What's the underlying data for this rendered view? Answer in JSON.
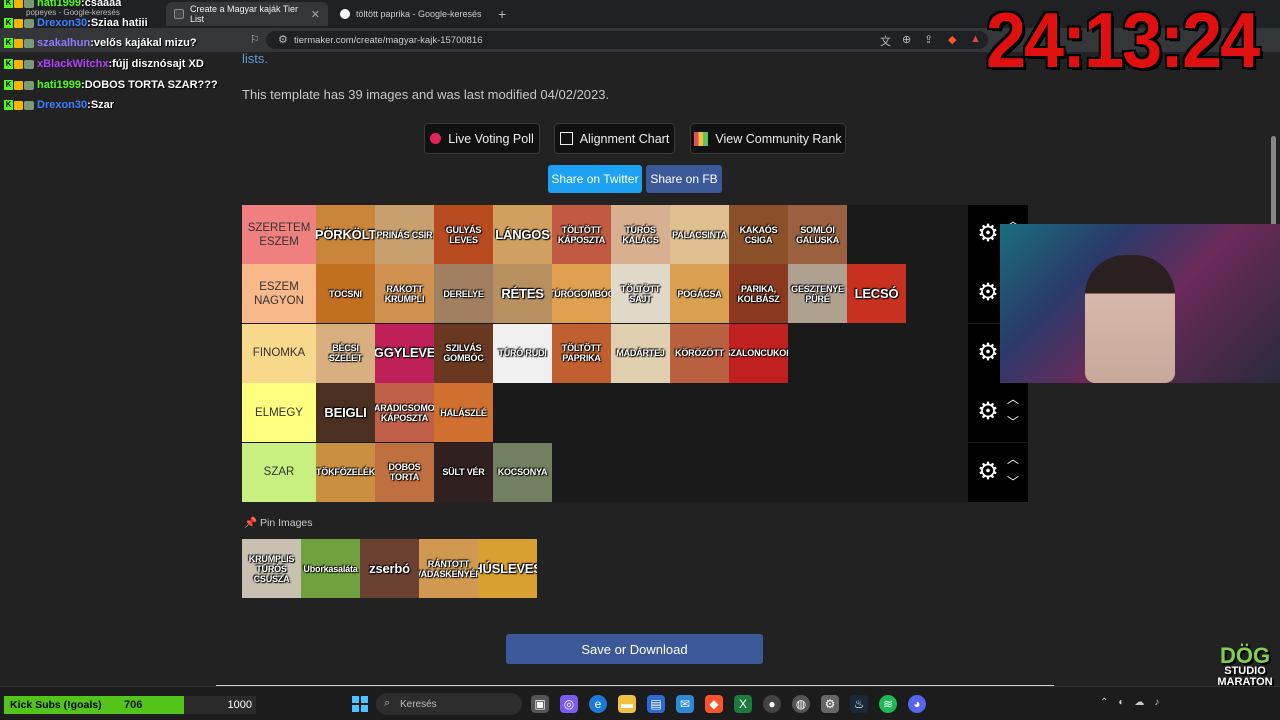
{
  "browser": {
    "tabs": [
      {
        "title": "Create a Magyar kaják Tier List",
        "active": true
      },
      {
        "title": "töltött paprika - Google-keresés",
        "active": false
      }
    ],
    "popup_tab": "popeyes - Google-keresés",
    "url": "tiermaker.com/create/magyar-kajk-15700816"
  },
  "page": {
    "lists_link": "lists.",
    "template_info": "This template has 39 images and was last modified 04/02/2023.",
    "buttons": {
      "live_voting": "Live Voting Poll",
      "alignment": "Alignment Chart",
      "community": "View Community Rank",
      "share_twitter": "Share on Twitter",
      "share_fb": "Share on FB",
      "save": "Save or Download"
    },
    "pin_label": "Pin Images",
    "tiers": [
      {
        "label": "SZERETEM ESZEM",
        "color": "#f08080",
        "items": [
          {
            "text": "PÖRKÖLT",
            "bg": "#c9853a",
            "big": true
          },
          {
            "text": "PRINÁS CSIR",
            "bg": "#c8a070"
          },
          {
            "text": "GULYÁS LEVES",
            "bg": "#b84a20"
          },
          {
            "text": "LÁNGOS",
            "bg": "#d0a060",
            "big": true
          },
          {
            "text": "TÖLTÖTT KÁPOSZTA",
            "bg": "#c05a40"
          },
          {
            "text": "TÚRÓS KALÁCS",
            "bg": "#d8b090"
          },
          {
            "text": "PALACSINTA",
            "bg": "#e0c090"
          },
          {
            "text": "KAKAÓS CSIGA",
            "bg": "#8a5028"
          },
          {
            "text": "SOMLÓI GALUSKA",
            "bg": "#9a6040"
          }
        ]
      },
      {
        "label": "ESZEM NAGYON",
        "color": "#f8b88a",
        "items": [
          {
            "text": "TOCSNI",
            "bg": "#c07020"
          },
          {
            "text": "RAKOTT KRUMPLI",
            "bg": "#d09050"
          },
          {
            "text": "DERELYE",
            "bg": "#a08060"
          },
          {
            "text": "RÉTES",
            "bg": "#b89060",
            "big": true
          },
          {
            "text": "TÚRÓGOMBÓC",
            "bg": "#e0a050"
          },
          {
            "text": "TÖLTÖTT SAJT",
            "bg": "#e0d8c8"
          },
          {
            "text": "POGÁCSA",
            "bg": "#d8a050"
          },
          {
            "text": "PARIKA, KOLBÁSZ",
            "bg": "#8a3820"
          },
          {
            "text": "GESZTENYE PÜRÉ",
            "bg": "#b0a090"
          },
          {
            "text": "LECSÓ",
            "bg": "#c83020",
            "big": true
          }
        ]
      },
      {
        "label": "FINOMKA",
        "color": "#f8d88a",
        "items": [
          {
            "text": "BÉCSI SZELET",
            "bg": "#d8b080"
          },
          {
            "text": "EGGYLEVES",
            "bg": "#c0205a",
            "big": true
          },
          {
            "text": "SZILVÁS GOMBÓC",
            "bg": "#6a3820"
          },
          {
            "text": "TÚRÓ RUDI",
            "bg": "#f0f0f0"
          },
          {
            "text": "TÖLTÖTT PAPRIKA",
            "bg": "#c06030"
          },
          {
            "text": "MADÁRTEJ",
            "bg": "#e0d0b0"
          },
          {
            "text": "KÖRÖZÖTT",
            "bg": "#b86040"
          },
          {
            "text": "SZALONCUKOR",
            "bg": "#c02020"
          }
        ]
      },
      {
        "label": "ELMEGY",
        "color": "#ffff80",
        "items": [
          {
            "text": "BEIGLI",
            "bg": "#4a3020",
            "big": true
          },
          {
            "text": "PARADICSOMOS KÁPOSZTA",
            "bg": "#c06048"
          },
          {
            "text": "HALÁSZLÉ",
            "bg": "#d07030"
          }
        ]
      },
      {
        "label": "SZAR",
        "color": "#c8f080",
        "items": [
          {
            "text": "TÖKFÖZELÉK",
            "bg": "#c89040"
          },
          {
            "text": "DOBOS TORTA",
            "bg": "#c07040"
          },
          {
            "text": "SÜLT VÉR",
            "bg": "#302020"
          },
          {
            "text": "KOCSONYA",
            "bg": "#708060"
          }
        ]
      }
    ],
    "pool": [
      {
        "text": "KRUMPLIS TÚRÓS CSUSZA",
        "bg": "#c8c0b0"
      },
      {
        "text": "Uborkasaláta",
        "bg": "#70a040"
      },
      {
        "text": "zserbó",
        "bg": "#6a4030",
        "big": true
      },
      {
        "text": "RÁNTOTT VADASKENYÉR",
        "bg": "#d09850"
      },
      {
        "text": "HÚSLEVES",
        "bg": "#d8a030",
        "big": true
      }
    ]
  },
  "overlay": {
    "timer": "24:13:24",
    "chat": [
      {
        "user": "hati1999",
        "color": "#53fc18",
        "text": "csaaaa"
      },
      {
        "user": "Drexon30",
        "color": "#3a80ff",
        "text": "Sziaa hatiii"
      },
      {
        "user": "szakalhun",
        "color": "#8a7aff",
        "text": "velős kajákal mizu?"
      },
      {
        "user": "xBlackWitchx",
        "color": "#b040ff",
        "text": "fújj disznósajt XD"
      },
      {
        "user": "hati1999",
        "color": "#53fc18",
        "text": "DOBOS TORTA SZAR???"
      },
      {
        "user": "Drexon30",
        "color": "#3a80ff",
        "text": "Szar"
      }
    ],
    "logo": {
      "top": "DÖG",
      "bottom": "STUDIO MARATON"
    }
  },
  "taskbar": {
    "kick_label": "Kick Subs (!goals)",
    "kick_count": "706",
    "kick_total": "1000",
    "search": "Keresés"
  }
}
